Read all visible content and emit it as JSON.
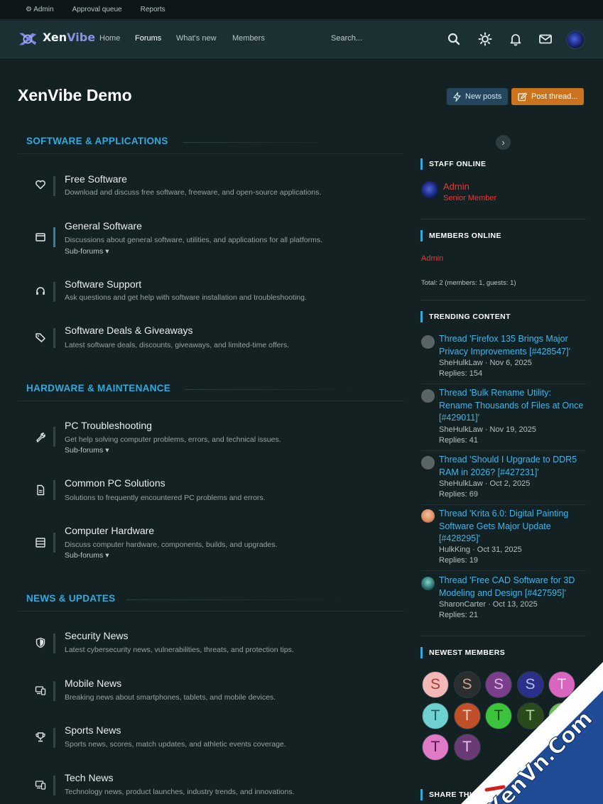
{
  "admin_bar": {
    "admin": "Admin",
    "approval": "Approval queue",
    "reports": "Reports"
  },
  "brand": {
    "xen": "Xen",
    "vibe": "Vibe"
  },
  "nav": {
    "home": "Home",
    "forums": "Forums",
    "whats_new": "What's new",
    "members": "Members",
    "search": "Search..."
  },
  "page": {
    "title": "XenVibe Demo",
    "new_posts": "New posts",
    "post_thread": "Post thread..."
  },
  "categories": [
    {
      "title": "SOFTWARE & APPLICATIONS",
      "forums": [
        {
          "title": "Free Software",
          "desc": "Download and discuss free software, freeware, and open-source applications.",
          "icon": "heart-icon"
        },
        {
          "title": "General Software",
          "desc": "Discussions about general software, utilities, and applications for all platforms.",
          "sub": "Sub-forums",
          "icon": "window-icon"
        },
        {
          "title": "Software Support",
          "desc": "Ask questions and get help with software installation and troubleshooting.",
          "icon": "headset-icon"
        },
        {
          "title": "Software Deals & Giveaways",
          "desc": "Latest software deals, discounts, giveaways, and limited-time offers.",
          "icon": "tags-icon"
        }
      ]
    },
    {
      "title": "HARDWARE & MAINTENANCE",
      "forums": [
        {
          "title": "PC Troubleshooting",
          "desc": "Get help solving computer problems, errors, and technical issues.",
          "sub": "Sub-forums",
          "icon": "wrench-icon"
        },
        {
          "title": "Common PC Solutions",
          "desc": "Solutions to frequently encountered PC problems and errors.",
          "icon": "document-icon"
        },
        {
          "title": "Computer Hardware",
          "desc": "Discuss computer hardware, components, builds, and upgrades.",
          "sub": "Sub-forums",
          "icon": "server-icon"
        }
      ]
    },
    {
      "title": "NEWS & UPDATES",
      "forums": [
        {
          "title": "Security News",
          "desc": "Latest cybersecurity news, vulnerabilities, threats, and protection tips.",
          "icon": "shield-icon"
        },
        {
          "title": "Mobile News",
          "desc": "Breaking news about smartphones, tablets, and mobile devices.",
          "icon": "devices-icon"
        },
        {
          "title": "Sports News",
          "desc": "Sports news, scores, match updates, and athletic events coverage.",
          "icon": "trophy-icon"
        },
        {
          "title": "Tech News",
          "desc": "Technology news, product launches, industry trends, and innovations.",
          "icon": "devices-icon"
        }
      ]
    }
  ],
  "sidebar": {
    "staff_online": "STAFF ONLINE",
    "staff": {
      "name": "Admin",
      "role": "Senior Member"
    },
    "members_online": "MEMBERS ONLINE",
    "online_member": "Admin",
    "total": "Total: 2 (members: 1, guests: 1)",
    "trending_title": "TRENDING CONTENT",
    "trending": [
      {
        "title": "Thread 'Firefox 135 Brings Major Privacy Improvements [#428547]'",
        "meta": "SheHulkLaw · Nov 6, 2025",
        "replies": "Replies: 154"
      },
      {
        "title": "Thread 'Bulk Rename Utility: Rename Thousands of Files at Once [#429011]'",
        "meta": "SheHulkLaw · Nov 19, 2025",
        "replies": "Replies: 41"
      },
      {
        "title": "Thread 'Should I Upgrade to DDR5 RAM in 2026? [#427231]'",
        "meta": "SheHulkLaw · Oct 2, 2025",
        "replies": "Replies: 69"
      },
      {
        "title": "Thread 'Krita 6.0: Digital Painting Software Gets Major Update [#428295]'",
        "meta": "HulkKing · Oct 31, 2025",
        "replies": "Replies: 19"
      },
      {
        "title": "Thread 'Free CAD Software for 3D Modeling and Design [#427595]'",
        "meta": "SharonCarter · Oct 13, 2025",
        "replies": "Replies: 21"
      }
    ],
    "newest_title": "NEWEST MEMBERS",
    "newest": [
      {
        "letter": "S",
        "bg": "#f2b8b8",
        "fg": "#a33b3b"
      },
      {
        "letter": "S",
        "bg": "#2b2e2e",
        "fg": "#c9a39a"
      },
      {
        "letter": "S",
        "bg": "#7a3e8a",
        "fg": "#e0b8ea"
      },
      {
        "letter": "S",
        "bg": "#2a2f8a",
        "fg": "#b7bcf2"
      },
      {
        "letter": "T",
        "bg": "#d865c0",
        "fg": "#f8d6f0"
      },
      {
        "letter": "T",
        "bg": "#6fd0d0",
        "fg": "#1d5f61"
      },
      {
        "letter": "T",
        "bg": "#c0502a",
        "fg": "#f6d2c2"
      },
      {
        "letter": "T",
        "bg": "#3bc43b",
        "fg": "#0e4a0e"
      },
      {
        "letter": "T",
        "bg": "#2a4a1c",
        "fg": "#b5d89e"
      },
      {
        "letter": "T",
        "bg": "#6fbf5a",
        "fg": "#1f4a14"
      },
      {
        "letter": "T",
        "bg": "#e07ac6",
        "fg": "#5a1449"
      },
      {
        "letter": "T",
        "bg": "#6a3a74",
        "fg": "#e4c2ec"
      }
    ],
    "share_title": "SHARE THIS"
  },
  "watermark": "XenVn.Com",
  "colors": {
    "accent": "#33a9dc",
    "link": "#3fb6e8",
    "staff": "#e03a3a",
    "post_button": "#c9731e"
  }
}
